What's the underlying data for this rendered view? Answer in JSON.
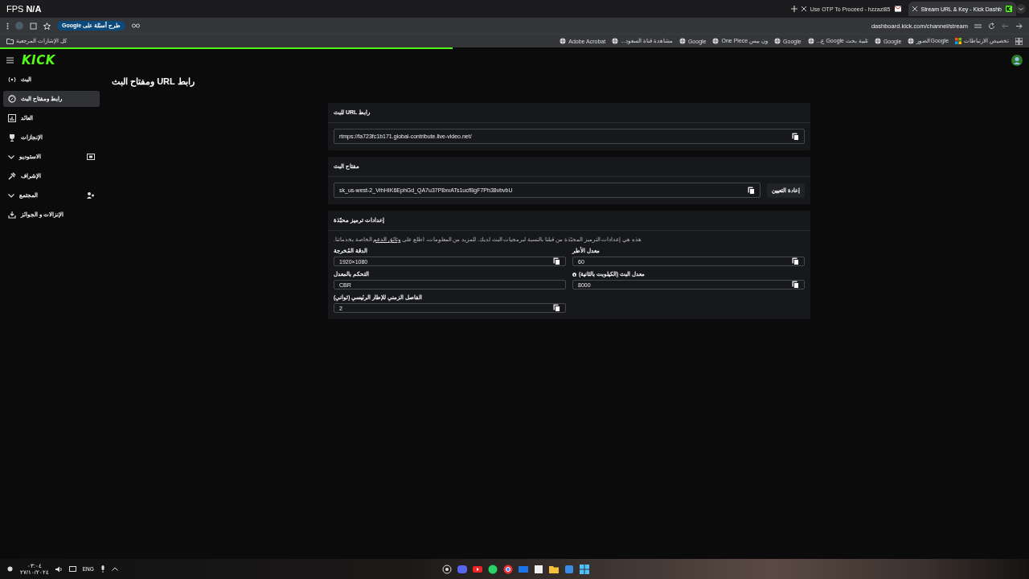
{
  "browser": {
    "fps_overlay": {
      "label": "FPS",
      "value": "N/A"
    },
    "tabs": [
      {
        "title": "Stream URL & Key - Kick Dashb",
        "selected": true
      },
      {
        "title": "Use OTP To Proceed - hzzazi85",
        "selected": false
      }
    ],
    "ask_chip": "طرح أسئلة على Google",
    "address": "dashboard.kick.com/channel/stream",
    "all_bookmarks": "كل الإشارات المرجعية",
    "bookmarks": [
      "تخصيص الارتباطات",
      "Googleالصور",
      "Google",
      "تلبية بحث Google ع...",
      "Google",
      "ون بيس One Piece",
      "Google",
      "مشاهدة قناة السعود...",
      "Adobe Acrobat"
    ],
    "load_progress": {
      "level": 0.44
    }
  },
  "sidebar": {
    "logo": "KICK",
    "items": [
      {
        "label": "البث",
        "selected": false,
        "expandable": false
      },
      {
        "label": "رابط ومفتاح البث",
        "selected": true,
        "expandable": false
      },
      {
        "label": "العائد",
        "selected": false,
        "expandable": false
      },
      {
        "label": "الإنجازات",
        "selected": false,
        "expandable": false
      },
      {
        "label": "الاستوديو",
        "selected": false,
        "expandable": true
      },
      {
        "label": "الإشراف",
        "selected": false,
        "expandable": false
      },
      {
        "label": "المجتمع",
        "selected": false,
        "expandable": true
      },
      {
        "label": "الإنزالات و الجوائز",
        "selected": false,
        "expandable": false
      }
    ]
  },
  "page_title": "رابط URL ومفتاح البث",
  "sections": [
    {
      "title": "رابط URL للبث",
      "fields": [
        {
          "value": "rtmps://fa723fc1b171.global-contribute.live-video.net/",
          "copy": true
        }
      ]
    },
    {
      "title": "مفتاح البث",
      "button": "إعادة التعيين",
      "fields": [
        {
          "value": "sk_us-west-2_VrhHIK6EphGd_QA7u37P8xvATs1ucfBgF7Ph38vbvbU",
          "copy": true
        }
      ]
    },
    {
      "title": "إعدادات ترميز محبّذة",
      "description": {
        "before": "هذه هي إعدادات الترميز المحبّذة من قبلنا بالنسبة لبرمجيات البث لديك. للمزيد من المعلومات، اطلع على ",
        "link": "وثائق الدعم",
        "after": " الخاصة بخدماتنا."
      },
      "fields": [
        {
          "label": "معدل الأطر",
          "value": "60",
          "copy": true,
          "info": false
        },
        {
          "label": "الدقة المُخرجة",
          "value": "1920×1080",
          "copy": true,
          "info": false
        },
        {
          "label": "معدل البث (الكيلوبت بالثانية)",
          "value": "8000",
          "copy": true,
          "info": true
        },
        {
          "label": "التحكم بالمعدل",
          "value": "CBR",
          "copy": false,
          "info": false
        },
        {
          "label": "الفاصل الزمني للإطار الرئيسي (ثواني)",
          "value": "2",
          "copy": true,
          "info": false
        }
      ]
    }
  ],
  "taskbar": {
    "time": "٠٣:٠٤",
    "date": "٢٧/١٠/٢٠٢٤",
    "language": "ENG"
  }
}
